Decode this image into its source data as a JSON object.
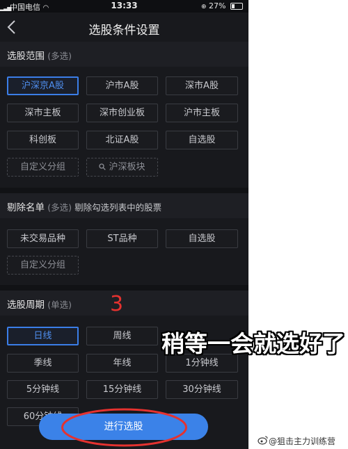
{
  "statusbar": {
    "carrier": "中国电信",
    "time": "13:33",
    "battery": "27%",
    "battery_level": 0.27
  },
  "navbar": {
    "title": "选股条件设置"
  },
  "scope": {
    "title": "选股范围",
    "subtitle": "(多选)",
    "chips": [
      "沪深京A股",
      "沪市A股",
      "深市A股",
      "深市主板",
      "深市创业板",
      "沪市主板",
      "科创板",
      "北证A股",
      "自选股",
      "自定义分组",
      "沪深板块"
    ],
    "selected": "沪深京A股"
  },
  "exclude": {
    "title": "剔除名单",
    "subtitle": "(多选)",
    "desc": "剔除勾选列表中的股票",
    "chips": [
      "未交易品种",
      "ST品种",
      "自选股",
      "自定义分组"
    ]
  },
  "period": {
    "title": "选股周期",
    "subtitle": "(单选)",
    "chips": [
      "日线",
      "周线",
      "季线",
      "年线",
      "1分钟线",
      "5分钟线",
      "15分钟线",
      "30分钟线",
      "60分钟线"
    ],
    "selected": "日线"
  },
  "annotation_number": "3",
  "overlay_caption": "稍等一会就选好了",
  "action_button": "进行选股",
  "watermark": "@狙击主力训练营",
  "colors": {
    "accent": "#3b82e8",
    "annotation_red": "#e5322f",
    "background": "#18191d"
  }
}
